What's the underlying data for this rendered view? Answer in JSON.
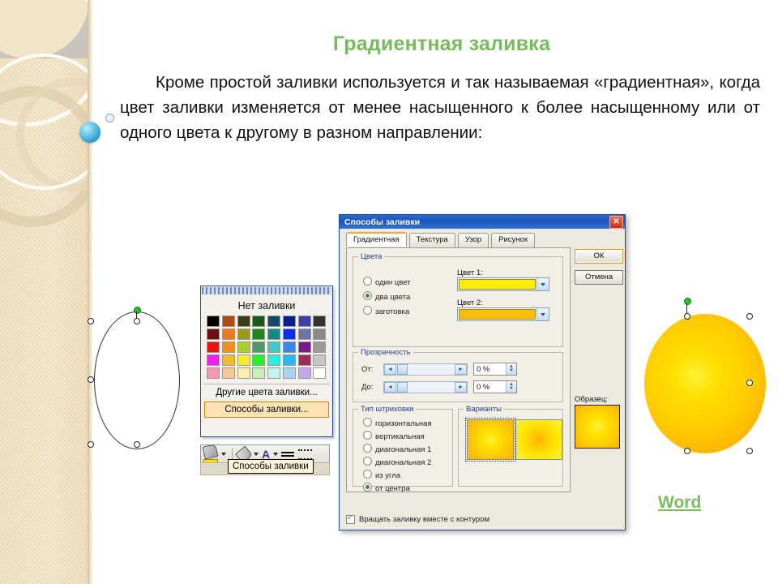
{
  "slide": {
    "title": "Градиентная заливка",
    "body": "Кроме простой заливки используется и так называемая «градиентная», когда цвет заливки изменяется от менее насыщенного к более насыщенному или от одного цвета к другому в разном направлении:",
    "caption": "Word",
    "accent_green": "#76bb5c",
    "sidebar_bg": "#f3e7cb"
  },
  "palette": {
    "title": "Нет заливки",
    "colors": [
      "#000000",
      "#b04a10",
      "#3b4010",
      "#1c5a1c",
      "#15496c",
      "#0a1f8c",
      "#3b3fa8",
      "#333333",
      "#6e0e0e",
      "#f07818",
      "#9a9a18",
      "#1c8a1c",
      "#128a8a",
      "#0a2ef0",
      "#6b74a8",
      "#8a8a8a",
      "#f01010",
      "#f09018",
      "#a8d028",
      "#4a9a6a",
      "#45c8c8",
      "#3a86f0",
      "#7a1a8a",
      "#9a9a9a",
      "#f01cf0",
      "#f0bc28",
      "#f8ec30",
      "#28f028",
      "#28f0e0",
      "#28b8f0",
      "#a02a5a",
      "#c6c6c6",
      "#f49ab8",
      "#f6c898",
      "#faeeb0",
      "#c6eeb8",
      "#c6f2f2",
      "#a8d4f6",
      "#c2a8f0",
      "#ffffff"
    ],
    "menu_items": [
      "Другие цвета заливки...",
      "Способы заливки..."
    ],
    "highlighted_item": "Способы заливки..."
  },
  "toolbar": {
    "tooltip": "Способы заливки",
    "icons": [
      "fill-bucket-icon",
      "pen-icon",
      "font-color-icon",
      "line-style-icon",
      "dash-style-icon"
    ]
  },
  "dialog": {
    "title": "Способы заливки",
    "close_label": "✕",
    "tabs": [
      {
        "label": "Градиентная",
        "active": true
      },
      {
        "label": "Текстура",
        "active": false
      },
      {
        "label": "Узор",
        "active": false
      },
      {
        "label": "Рисунок",
        "active": false
      }
    ],
    "colors_group": {
      "label": "Цвета",
      "options": [
        {
          "label": "один цвет",
          "selected": false
        },
        {
          "label": "два цвета",
          "selected": true
        },
        {
          "label": "заготовка",
          "selected": false
        }
      ],
      "color1_label": "Цвет 1:",
      "color1_value": "#ffee00",
      "color2_label": "Цвет 2:",
      "color2_value": "#ffbe00"
    },
    "transparency_group": {
      "label": "Прозрачность",
      "from_label": "От:",
      "from_value": "0 %",
      "to_label": "До:",
      "to_value": "0 %"
    },
    "hatch_group": {
      "label": "Тип штриховки",
      "options": [
        {
          "label": "горизонтальная",
          "selected": false
        },
        {
          "label": "вертикальная",
          "selected": false
        },
        {
          "label": "диагональная 1",
          "selected": false
        },
        {
          "label": "диагональная 2",
          "selected": false
        },
        {
          "label": "из угла",
          "selected": false
        },
        {
          "label": "от центра",
          "selected": true
        }
      ]
    },
    "variants_group": {
      "label": "Варианты",
      "items": [
        {
          "name": "variant-1",
          "selected": true
        },
        {
          "name": "variant-2",
          "selected": false
        }
      ]
    },
    "sample_label": "Образец:",
    "rotate_checkbox": {
      "label": "Вращать заливку вместе с контуром",
      "checked": true
    },
    "buttons": {
      "ok": "ОК",
      "cancel": "Отмена"
    }
  },
  "shapes": {
    "empty_circle_name": "unfilled-circle-shape",
    "gradient_circle_name": "gradient-filled-circle-shape",
    "gradient_center": "#fff23a",
    "gradient_edge": "#ffa800"
  }
}
